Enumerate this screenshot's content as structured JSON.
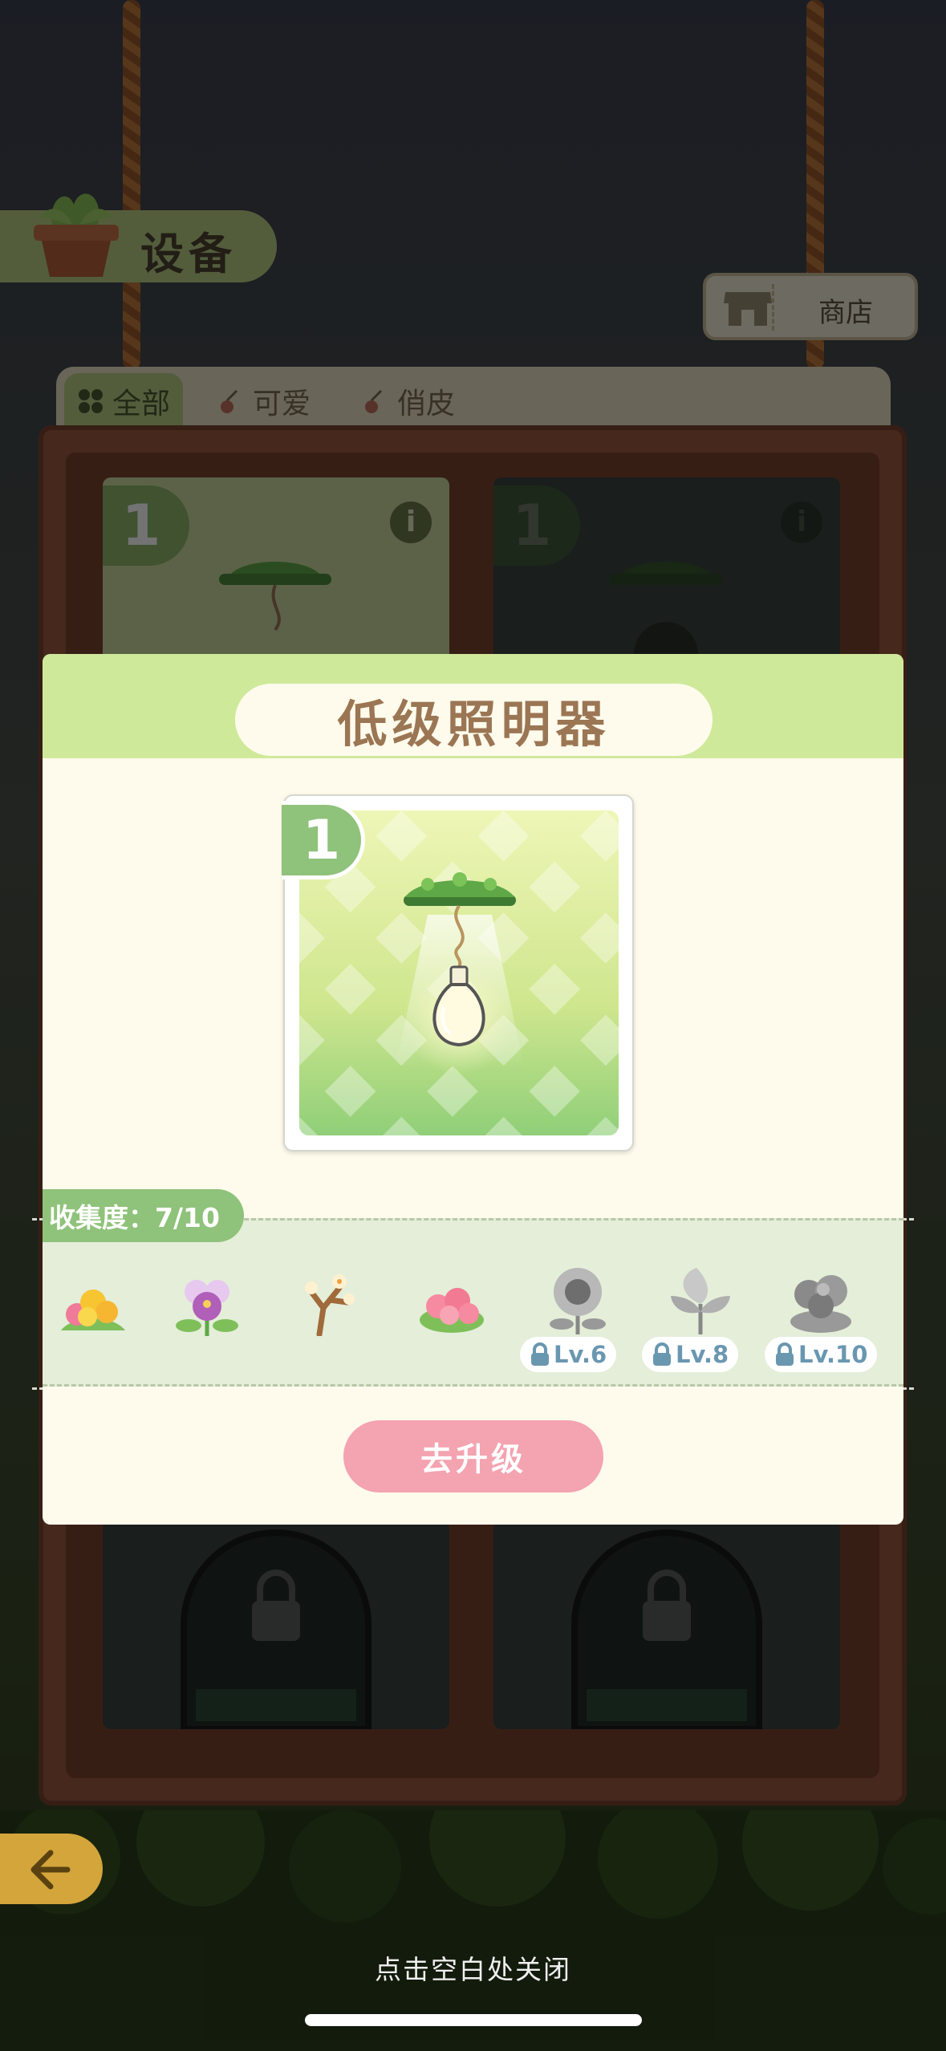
{
  "header": {
    "title": "设备",
    "shop_label": "商店"
  },
  "tabs": [
    {
      "label": "全部",
      "active": true
    },
    {
      "label": "可爱",
      "active": false
    },
    {
      "label": "俏皮",
      "active": false
    }
  ],
  "grid": {
    "slot_numbers": [
      "1",
      "1"
    ],
    "info_glyph": "i"
  },
  "modal": {
    "title": "低级照明器",
    "card_number": "1",
    "collection_label": "收集度：7/10",
    "items": [
      {
        "name": "yellow-flower-bunch",
        "locked": false,
        "level": ""
      },
      {
        "name": "purple-pansy",
        "locked": false,
        "level": ""
      },
      {
        "name": "plum-blossom-branch",
        "locked": false,
        "level": ""
      },
      {
        "name": "pink-azalea",
        "locked": false,
        "level": ""
      },
      {
        "name": "sunflower",
        "locked": true,
        "level": "Lv.6"
      },
      {
        "name": "leaf-plant",
        "locked": true,
        "level": "Lv.8"
      },
      {
        "name": "rose",
        "locked": true,
        "level": "Lv.10"
      }
    ],
    "upgrade_label": "去升级"
  },
  "footer": {
    "close_hint": "点击空白处关闭"
  },
  "colors": {
    "accent_green": "#8fc27a",
    "header_green": "#cfe99b",
    "title_brown": "#9b7654",
    "upgrade_pink": "#f4a3b0",
    "lock_blue": "#6a97b0"
  }
}
